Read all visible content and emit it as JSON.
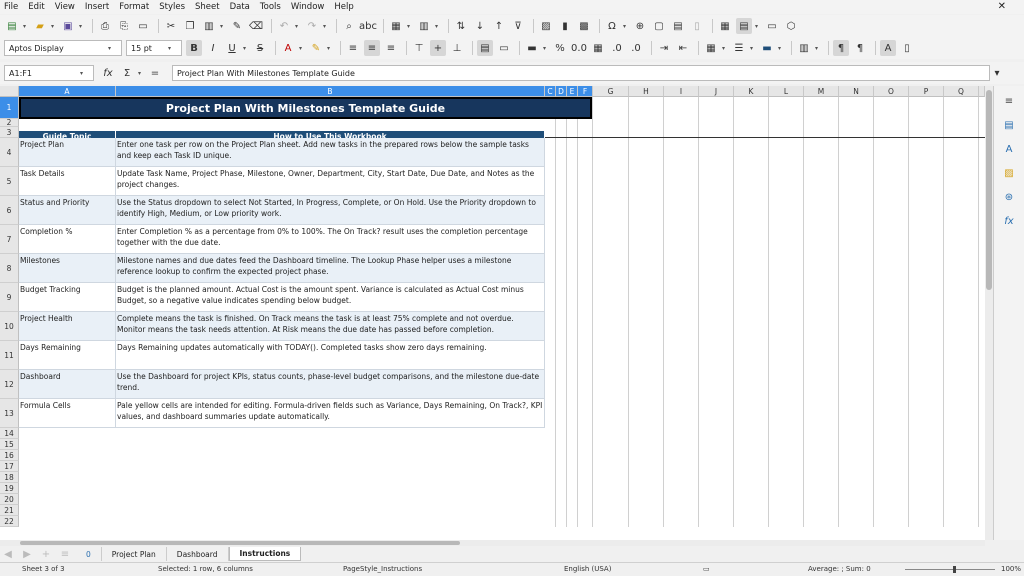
{
  "menu": [
    "File",
    "Edit",
    "View",
    "Insert",
    "Format",
    "Styles",
    "Sheet",
    "Data",
    "Tools",
    "Window",
    "Help"
  ],
  "close_glyph": "✕",
  "font": {
    "name": "Aptos Display",
    "size": "15 pt"
  },
  "formula_bar": {
    "cell_ref": "A1:F1",
    "content": "Project Plan With Milestones Template Guide"
  },
  "columns": [
    "A",
    "B",
    "C",
    "D",
    "E",
    "F",
    "G",
    "H",
    "I",
    "J",
    "K",
    "L",
    "M",
    "N",
    "O",
    "P",
    "Q"
  ],
  "rows": [
    "1",
    "2",
    "3",
    "4",
    "5",
    "6",
    "7",
    "8",
    "9",
    "10",
    "11",
    "12",
    "13",
    "14",
    "15",
    "16",
    "17",
    "18",
    "19",
    "20",
    "21",
    "22"
  ],
  "sheet": {
    "title": "Project Plan With Milestones Template Guide",
    "header_topic": "Guide Topic",
    "header_howto": "How to Use This Workbook",
    "entries": [
      {
        "topic": "Project Plan",
        "text": "Enter one task per row on the Project Plan sheet. Add new tasks in the prepared rows below the sample tasks and keep each Task ID unique."
      },
      {
        "topic": "Task Details",
        "text": "Update Task Name, Project Phase, Milestone, Owner, Department, City, Start Date, Due Date, and Notes as the project changes."
      },
      {
        "topic": "Status and Priority",
        "text": "Use the Status dropdown to select Not Started, In Progress, Complete, or On Hold. Use the Priority dropdown to identify High, Medium, or Low priority work."
      },
      {
        "topic": "Completion %",
        "text": "Enter Completion % as a percentage from 0% to 100%. The On Track? result uses the completion percentage together with the due date."
      },
      {
        "topic": "Milestones",
        "text": "Milestone names and due dates feed the Dashboard timeline. The Lookup Phase helper uses a milestone reference lookup to confirm the expected project phase."
      },
      {
        "topic": "Budget Tracking",
        "text": "Budget is the planned amount. Actual Cost is the amount spent. Variance is calculated as Actual Cost minus Budget, so a negative value indicates spending below budget."
      },
      {
        "topic": "Project Health",
        "text": "Complete means the task is finished. On Track means the task is at least 75% complete and not overdue. Monitor means the task needs attention. At Risk means the due date has passed before completion."
      },
      {
        "topic": "Days Remaining",
        "text": "Days Remaining updates automatically with TODAY(). Completed tasks show zero days remaining."
      },
      {
        "topic": "Dashboard",
        "text": "Use the Dashboard for project KPIs, status counts, phase-level budget comparisons, and the milestone due-date trend."
      },
      {
        "topic": "Formula Cells",
        "text": "Pale yellow cells are intended for editing. Formula-driven fields such as Variance, Days Remaining, On Track?, KPI values, and dashboard summaries update automatically."
      }
    ]
  },
  "tabs": [
    "Project Plan",
    "Dashboard",
    "Instructions"
  ],
  "tab_badge": "0",
  "active_tab": "Instructions",
  "status": {
    "sheet": "Sheet 3 of 3",
    "selection": "Selected: 1 row, 6 columns",
    "page_style": "PageStyle_Instructions",
    "language": "English (USA)",
    "sum": "Average: ; Sum: 0",
    "zoom": "100%"
  }
}
